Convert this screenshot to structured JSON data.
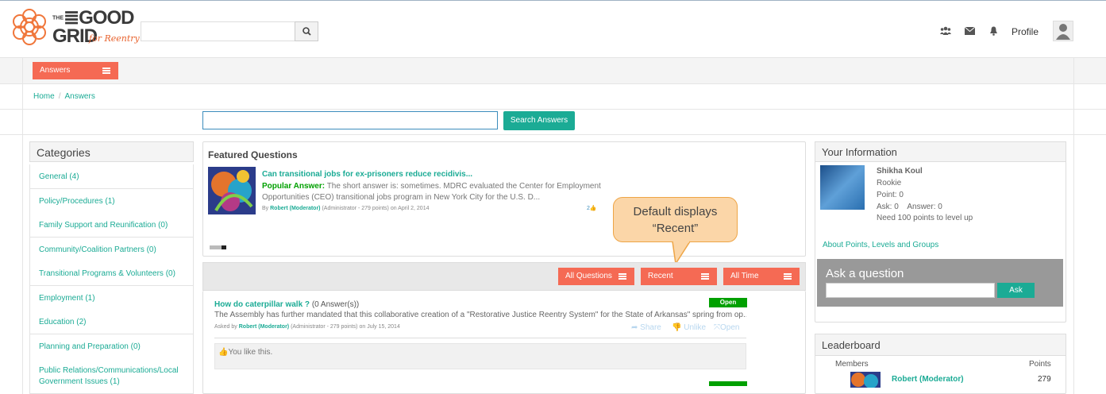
{
  "header": {
    "logo_line1": "≣GOOD",
    "logo_line1_prefix": "THE",
    "logo_line2": "GRID",
    "logo_sub": "for Reentry",
    "search_placeholder": "",
    "profile_label": "Profile"
  },
  "nav": {
    "answers_label": "Answers"
  },
  "breadcrumb": {
    "home": "Home",
    "separator": "/",
    "current": "Answers"
  },
  "answers_search": {
    "placeholder": "",
    "button_label": "Search Answers"
  },
  "categories": {
    "title": "Categories",
    "items": [
      "General (4)",
      "Policy/Procedures (1)",
      "Family Support and Reunification (0)",
      "Community/Coalition Partners (0)",
      "Transitional Programs & Volunteers (0)",
      "Employment (1)",
      "Education (2)",
      "Planning and Preparation (0)",
      "Public Relations/Communications/Local",
      "Government Issues (1)"
    ]
  },
  "featured": {
    "title": "Featured Questions",
    "question_title": "Can transitional jobs for ex-prisoners reduce recidivis...",
    "popular_label": "Popular Answer:",
    "answer_line1": "The short answer is: sometimes. MDRC evaluated the Center for Employment",
    "answer_line2": "Opportunities (CEO) transitional jobs program in New York City for the U.S. D...",
    "meta_by": "By",
    "meta_author": "Robert (Moderator)",
    "meta_rest": "(Administrator - 279 points)  on April 2, 2014",
    "likes": "2"
  },
  "callout": {
    "line1": "Default displays",
    "line2": "“Recent”"
  },
  "filters": {
    "all_questions": "All Questions",
    "recent": "Recent",
    "all_time": "All Time"
  },
  "question": {
    "title": "How do caterpillar walk ?",
    "answers_count": "(0 Answer(s))",
    "status": "Open",
    "body": "The Assembly has further mandated that this collaborative creation of a \"Restorative Justice Reentry System\" for the State of Arkansas\" spring from op...",
    "meta_asked": "Asked by",
    "meta_author": "Robert (Moderator)",
    "meta_rest": "(Administrator - 279 points)  on July 15, 2014",
    "share": "Share",
    "unlike": "Unlike",
    "open": "Open",
    "you_like": "You like this."
  },
  "your_info": {
    "title": "Your Information",
    "name": "Shikha Koul",
    "rank": "Rookie",
    "points": "Point: 0",
    "ask_answer": "Ask: 0    Answer: 0",
    "need": "Need 100 points to level up",
    "about_link": "About Points, Levels and Groups"
  },
  "ask": {
    "title": "Ask a question",
    "button": "Ask"
  },
  "leaderboard": {
    "title": "Leaderboard",
    "col_members": "Members",
    "col_points": "Points",
    "row_name": "Robert (Moderator)",
    "row_points": "279"
  },
  "colors": {
    "accent": "#f56a54",
    "teal": "#1bab95",
    "open_green": "#00a000"
  }
}
